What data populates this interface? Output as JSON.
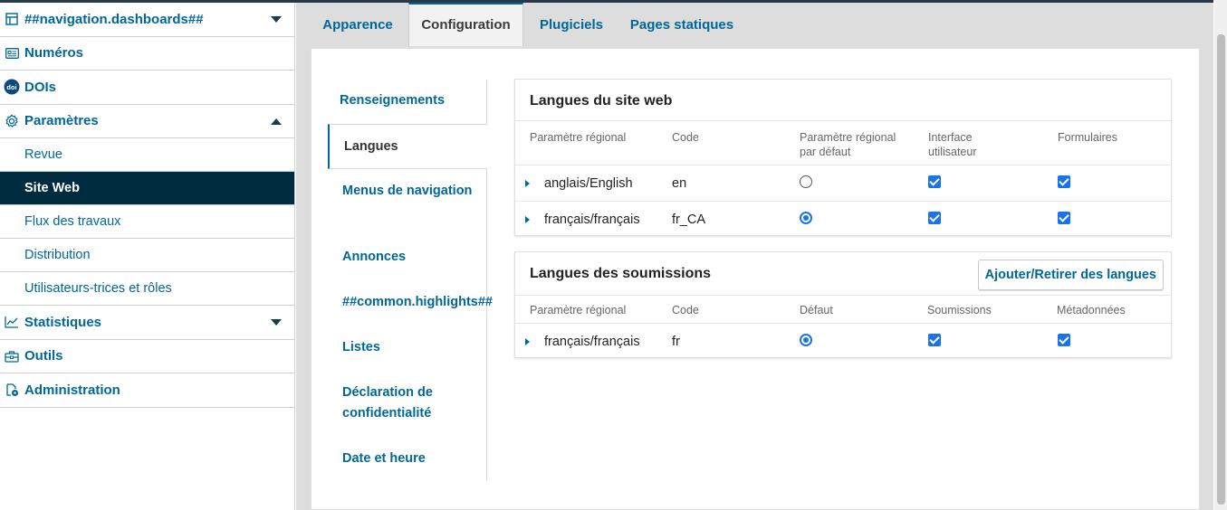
{
  "sidebar": {
    "dashboards": "##navigation.dashboards##",
    "issues": "Numéros",
    "dois": "DOIs",
    "settings": "Paramètres",
    "settings_sub": [
      "Revue",
      "Site Web",
      "Flux des travaux",
      "Distribution",
      "Utilisateurs-trices et rôles"
    ],
    "statistics": "Statistiques",
    "tools": "Outils",
    "administration": "Administration"
  },
  "tabs": [
    "Apparence",
    "Configuration",
    "Plugiciels",
    "Pages statiques"
  ],
  "active_tab": "Configuration",
  "subtabs": [
    "Renseignements",
    "Langues",
    "Menus de navigation",
    "Annonces",
    "##common.highlights##",
    "Listes",
    "Déclaration de confidentialité",
    "Date et heure"
  ],
  "active_subtab": "Langues",
  "site_languages": {
    "title": "Langues du site web",
    "headers": [
      "Paramètre régional",
      "Code",
      "Paramètre régional par défaut",
      "Interface utilisateur",
      "Formulaires"
    ],
    "rows": [
      {
        "locale": "anglais/English",
        "code": "en",
        "default": false,
        "ui": true,
        "forms": true
      },
      {
        "locale": "français/français",
        "code": "fr_CA",
        "default": true,
        "ui": true,
        "forms": true
      }
    ]
  },
  "submission_languages": {
    "title": "Langues des soumissions",
    "button": "Ajouter/Retirer des langues",
    "headers": [
      "Paramètre régional",
      "Code",
      "Défaut",
      "Soumissions",
      "Métadonnées"
    ],
    "rows": [
      {
        "locale": "français/français",
        "code": "fr",
        "default": true,
        "submissions": true,
        "metadata": true
      }
    ]
  },
  "colors": {
    "accent": "#006798",
    "active_nav": "#002c40",
    "checkbox": "#1a73e8"
  }
}
